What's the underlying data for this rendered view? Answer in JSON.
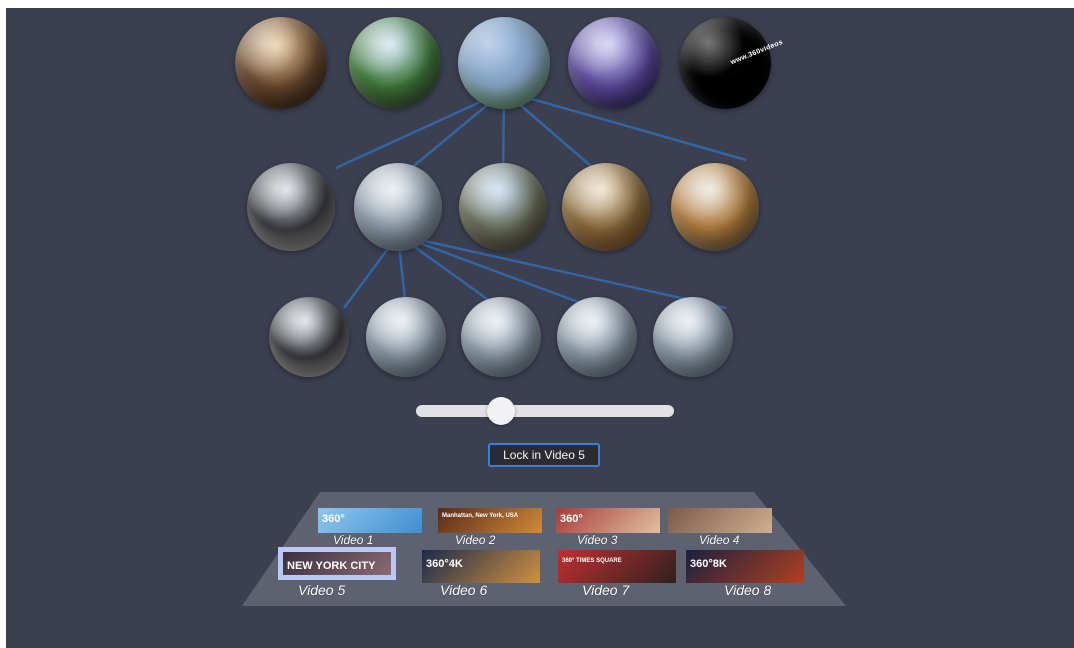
{
  "spheres": {
    "top_row": [
      {
        "name": "sphere-city-street",
        "colors": [
          "#e7c9a0",
          "#6b4a30",
          "#2a1a10"
        ]
      },
      {
        "name": "sphere-park-trees",
        "colors": [
          "#cfe3f5",
          "#3f7a3a",
          "#3a3a34"
        ]
      },
      {
        "name": "sphere-park-lawn",
        "colors": [
          "#8fb0d8",
          "#88a7c6",
          "#4e8a2e"
        ]
      },
      {
        "name": "sphere-times-square",
        "colors": [
          "#c9c6f2",
          "#5a4a9a",
          "#2a2050"
        ]
      },
      {
        "name": "sphere-black",
        "colors": [
          "#0a0a0a",
          "#000000",
          "#000000"
        ],
        "text": "www.360videos"
      }
    ],
    "middle_row": [
      {
        "name": "sphere-nypd",
        "colors": [
          "#d8dde4",
          "#3a3b40",
          "#d9d4c8"
        ]
      },
      {
        "name": "sphere-oculus-1",
        "colors": [
          "#e6ebf0",
          "#8a9aa8",
          "#5f6a75"
        ]
      },
      {
        "name": "sphere-pond-skyline",
        "colors": [
          "#c5dbf2",
          "#6a6f5a",
          "#4a3a2a"
        ]
      },
      {
        "name": "sphere-autumn-trees",
        "colors": [
          "#eadfc8",
          "#8a6a3a",
          "#7a4a28"
        ]
      },
      {
        "name": "sphere-autumn-lake",
        "colors": [
          "#e8e4d8",
          "#b07a3a",
          "#5a5a4a"
        ]
      }
    ],
    "bottom_row": [
      {
        "name": "sphere-nypd-2",
        "colors": [
          "#d8dde4",
          "#3a3b40",
          "#e6e2d8"
        ]
      },
      {
        "name": "sphere-oculus-2",
        "colors": [
          "#e6ebf0",
          "#8a9aa8",
          "#5f6a75"
        ]
      },
      {
        "name": "sphere-oculus-3",
        "colors": [
          "#e6ebf0",
          "#8a9aa8",
          "#5f6a75"
        ]
      },
      {
        "name": "sphere-oculus-4",
        "colors": [
          "#e6ebf0",
          "#8a9aa8",
          "#5f6a75"
        ]
      },
      {
        "name": "sphere-oculus-5",
        "colors": [
          "#e6ebf0",
          "#8a9aa8",
          "#5f6a75"
        ]
      }
    ]
  },
  "link_color": "#2f6fb8",
  "slider": {
    "value_fraction": 0.33
  },
  "lock_button": {
    "label": "Lock in Video 5",
    "border_color": "#3c7ee0"
  },
  "videos": [
    {
      "label": "Video 1",
      "overlay": "360°",
      "colors": [
        "#8fc6ee",
        "#3f8fd0"
      ],
      "selected": false
    },
    {
      "label": "Video 2",
      "overlay": "Manhattan, New York, USA",
      "colors": [
        "#5a2a1a",
        "#d08a3a"
      ],
      "selected": false
    },
    {
      "label": "Video 3",
      "overlay": "360°",
      "colors": [
        "#a83a3a",
        "#e0c0a0"
      ],
      "selected": false
    },
    {
      "label": "Video 4",
      "overlay": "",
      "colors": [
        "#7a5a4a",
        "#d0b090"
      ],
      "selected": false
    },
    {
      "label": "Video 5",
      "overlay": "NEW YORK CITY",
      "colors": [
        "#3a3040",
        "#8a6a70"
      ],
      "selected": true
    },
    {
      "label": "Video 6",
      "overlay": "360°4K",
      "colors": [
        "#1a2a4a",
        "#d09040"
      ],
      "selected": false
    },
    {
      "label": "Video 7",
      "overlay": "360° TIMES SQUARE",
      "colors": [
        "#c03030",
        "#302020"
      ],
      "selected": false
    },
    {
      "label": "Video 8",
      "overlay": "360°8K",
      "colors": [
        "#1a2040",
        "#b04020"
      ],
      "selected": false
    }
  ],
  "floor_color": "#5d6170",
  "selected_highlight": "#b9c8f4"
}
